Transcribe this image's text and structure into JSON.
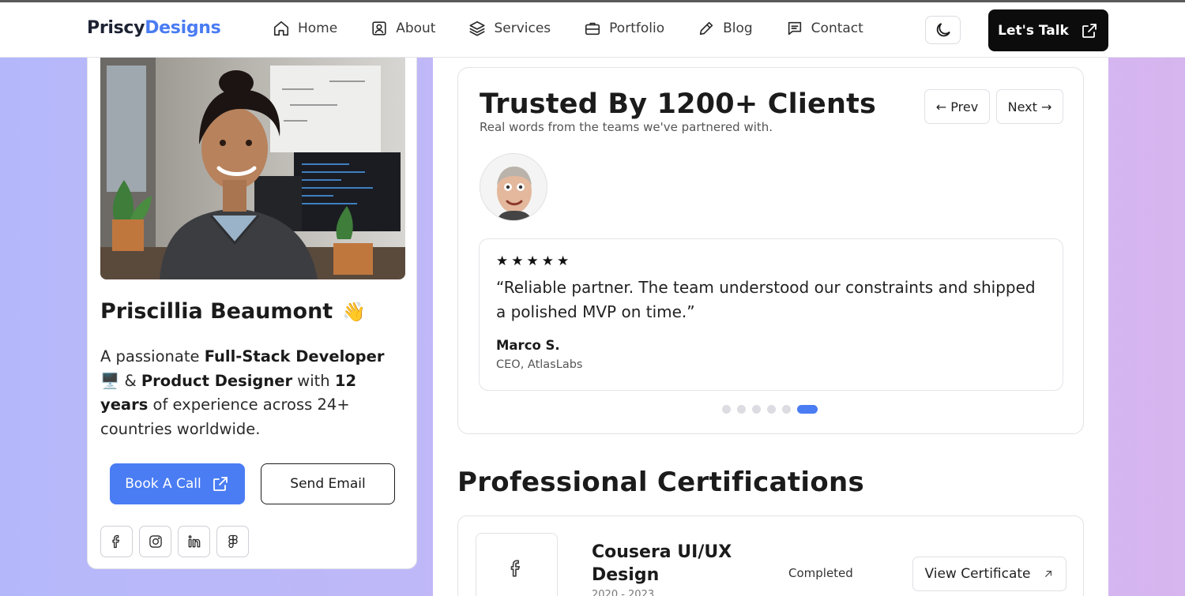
{
  "brand": {
    "part1": "Priscy",
    "part2": "Designs"
  },
  "nav": [
    {
      "label": "Home",
      "icon": "home-icon"
    },
    {
      "label": "About",
      "icon": "user-square-icon"
    },
    {
      "label": "Services",
      "icon": "layers-icon"
    },
    {
      "label": "Portfolio",
      "icon": "briefcase-icon"
    },
    {
      "label": "Blog",
      "icon": "pencil-icon"
    },
    {
      "label": "Contact",
      "icon": "message-icon"
    }
  ],
  "header": {
    "cta": "Let's Talk",
    "theme_icon": "moon-icon"
  },
  "profile": {
    "name": "Priscillia Beaumont",
    "wave": "👋",
    "bio": {
      "t1": "A passionate ",
      "b1": "Full-Stack Developer",
      "emoji": " 🖥️ &",
      "b2": "Product Designer",
      "t2": " with ",
      "b3": "12 years",
      "t3": " of experience across 24+ countries worldwide."
    },
    "book_call": "Book A Call",
    "send_email": "Send Email",
    "socials": [
      "facebook-icon",
      "instagram-icon",
      "linkedin-icon",
      "figma-icon"
    ]
  },
  "testimonials": {
    "title": "Trusted By 1200+ Clients",
    "subtitle": "Real words from the teams we've partnered with.",
    "prev": "← Prev",
    "next": "Next →",
    "stars": [
      "★",
      "★",
      "★",
      "★",
      "★"
    ],
    "quote": "“Reliable partner. The team understood our constraints and shipped a polished MVP on time.”",
    "author": "Marco S.",
    "role": "CEO, AtlasLabs",
    "active_slide": 6,
    "slide_count": 6
  },
  "certifications": {
    "title": "Professional Certifications",
    "items": [
      {
        "name": "Cousera UI/UX Design",
        "years": "2020 - 2023",
        "status": "Completed",
        "button": "View Certificate",
        "icon": "facebook-icon"
      }
    ]
  },
  "colors": {
    "accent": "#4a7cf3",
    "dark": "#0c0c0c",
    "brand_dark": "#1d2333"
  }
}
